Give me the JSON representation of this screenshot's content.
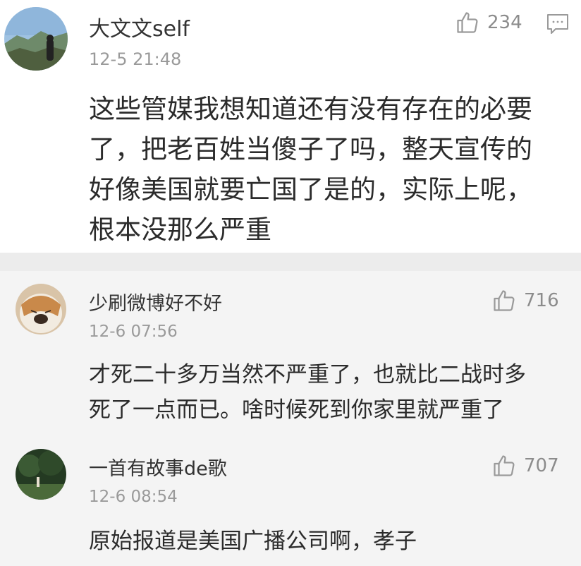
{
  "main_comment": {
    "username": "大文文self",
    "timestamp": "12-5 21:48",
    "likes": "234",
    "lines": [
      "这些管媒我想知道还有没有存在的必要",
      "了，把老百姓当傻子了吗，整天宣传的",
      "好像美国就要亡国了是的，实际上呢，",
      "根本没那么严重"
    ]
  },
  "replies": [
    {
      "username": "少刷微博好不好",
      "timestamp": "12-6 07:56",
      "likes": "716",
      "lines": [
        "才死二十多万当然不严重了，也就比二战时多",
        "死了一点而已。啥时候死到你家里就严重了"
      ]
    },
    {
      "username": "一首有故事de歌",
      "timestamp": "12-6 08:54",
      "likes": "707",
      "lines": [
        "原始报道是美国广播公司啊，孝子"
      ]
    }
  ],
  "icons": {
    "like": "thumbs-up-icon",
    "comment": "comment-bubble-icon"
  }
}
